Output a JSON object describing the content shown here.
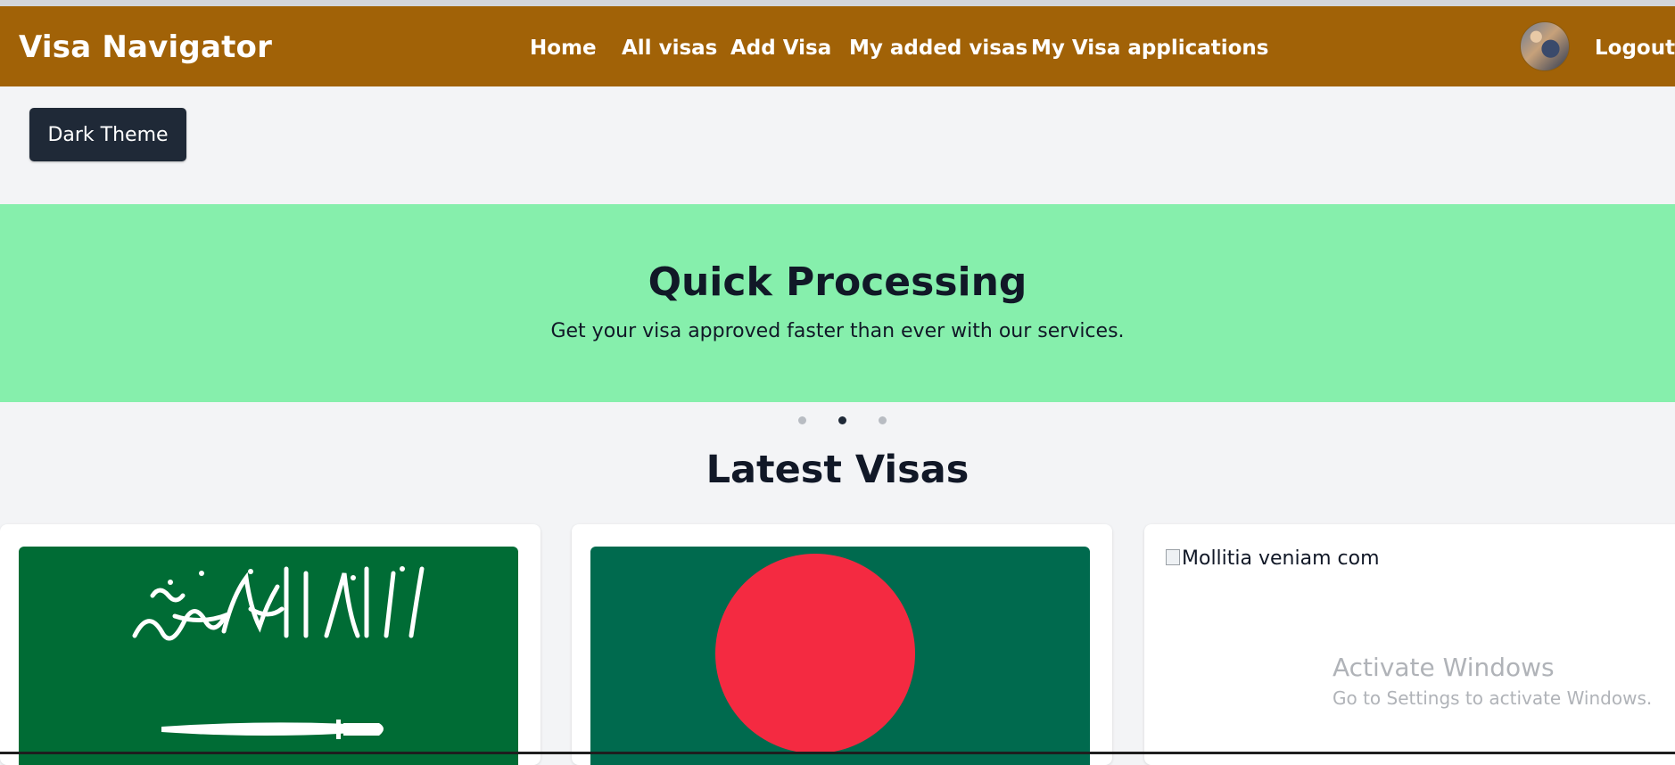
{
  "navbar": {
    "brand": "Visa Navigator",
    "links": [
      "Home",
      "All visas",
      "Add Visa",
      "My added visas",
      "My Visa applications"
    ],
    "logout": "Logout",
    "background": "#a16207"
  },
  "theme_button": {
    "label": "Dark Theme"
  },
  "carousel": {
    "title": "Quick Processing",
    "subtitle": "Get your visa approved faster than ever with our services.",
    "background": "#86efac",
    "slide_count": 3,
    "active_slide": 2
  },
  "latest": {
    "title": "Latest Visas",
    "cards": [
      {
        "image": "saudi-arabia-flag"
      },
      {
        "image": "bangladesh-flag"
      },
      {
        "image_alt": "Mollitia veniam com"
      }
    ]
  },
  "watermark": {
    "title": "Activate Windows",
    "subtitle": "Go to Settings to activate Windows."
  }
}
